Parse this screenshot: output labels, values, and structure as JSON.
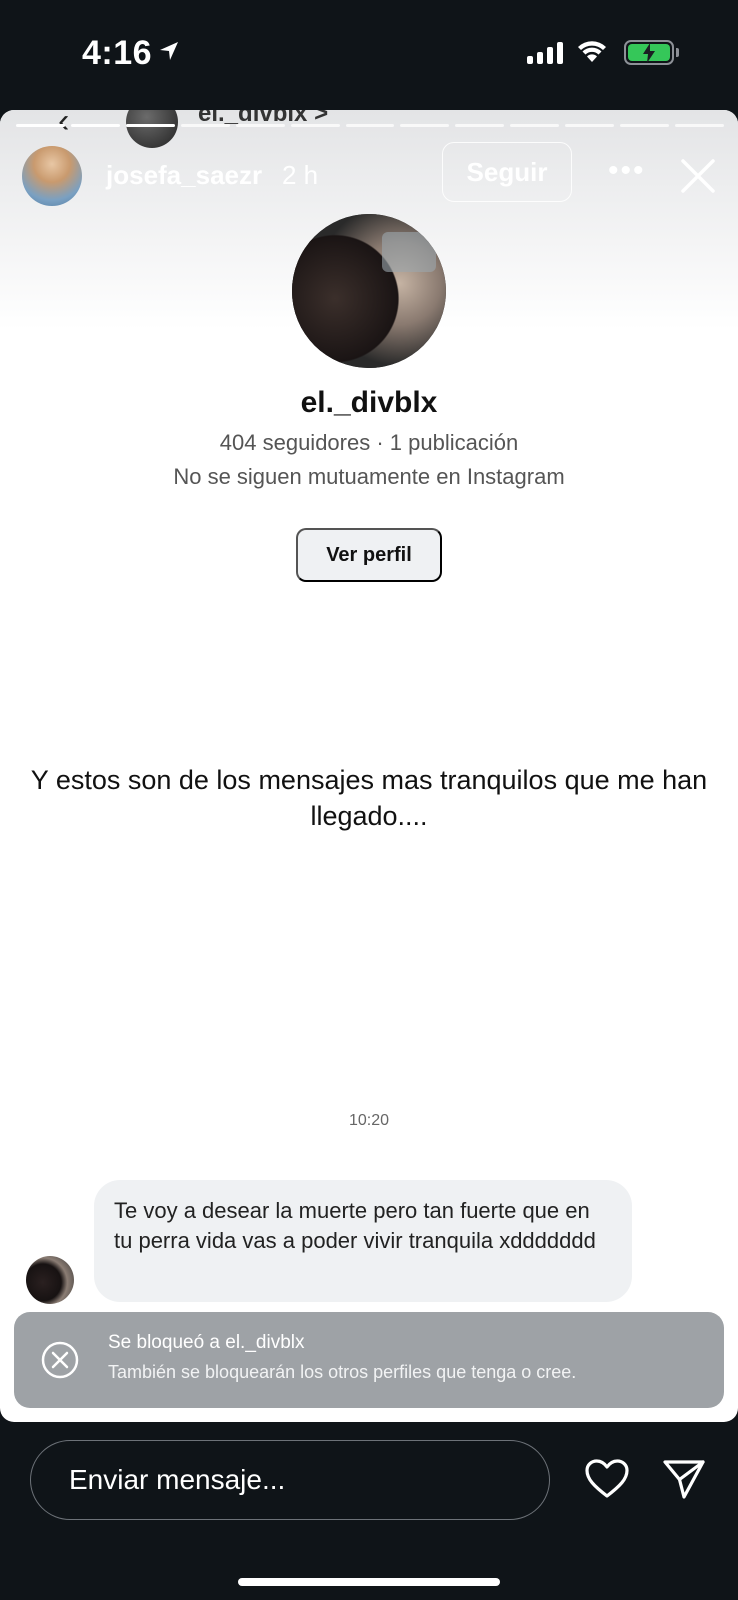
{
  "status_bar": {
    "time": "4:16",
    "battery_color": "#35c759"
  },
  "peek_header": {
    "username": "el._divblx",
    "chevron": ">"
  },
  "story": {
    "owner_username": "josefa_saezr",
    "time_ago": "2 h",
    "follow_label": "Seguir",
    "more_icon": "more-icon",
    "close_icon": "close-icon",
    "progress_segments_total": 13,
    "progress_segments_done": 3
  },
  "profile": {
    "username": "el._divblx",
    "stats": "404 seguidores · 1 publicación",
    "mutual": "No se siguen mutuamente en Instagram",
    "view_profile_label": "Ver perfil"
  },
  "caption": "Y estos son de los mensajes mas tranquilos que me han llegado....",
  "chat": {
    "time": "10:20",
    "message": "Te voy a desear la muerte pero tan fuerte que en tu perra vida vas a poder vivir tranquila xddddddd"
  },
  "toast": {
    "title": "Se bloqueó a el._divblx",
    "subtitle": "También se bloquearán los otros perfiles que tenga o cree."
  },
  "bottom_bar": {
    "message_placeholder": "Enviar mensaje...",
    "heart_icon": "heart-icon",
    "send_icon": "send-icon"
  }
}
